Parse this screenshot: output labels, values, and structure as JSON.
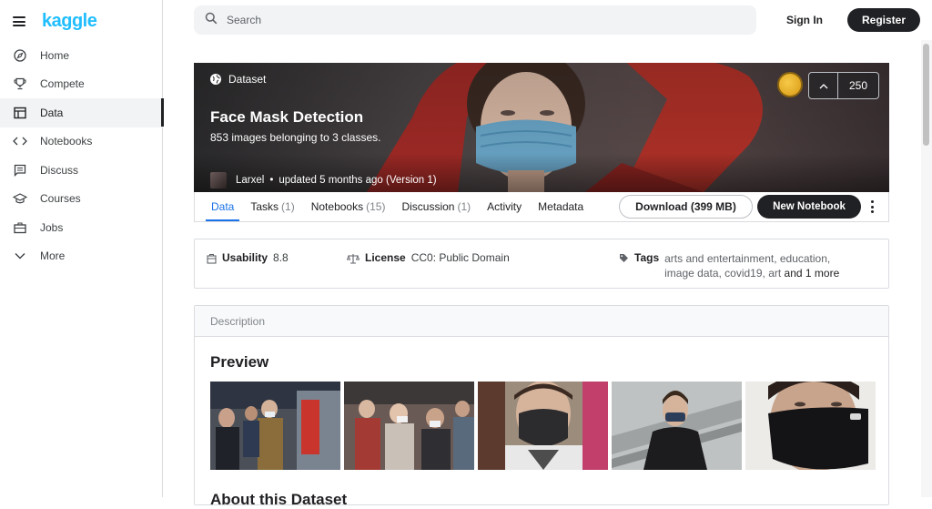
{
  "brand": {
    "logo": "kaggle",
    "logo_color": "#20beff"
  },
  "sidebar": {
    "items": [
      {
        "label": "Home",
        "icon": "compass-icon"
      },
      {
        "label": "Compete",
        "icon": "trophy-icon"
      },
      {
        "label": "Data",
        "icon": "table-icon",
        "active": true
      },
      {
        "label": "Notebooks",
        "icon": "code-icon"
      },
      {
        "label": "Discuss",
        "icon": "comment-icon"
      },
      {
        "label": "Courses",
        "icon": "graduation-cap-icon"
      },
      {
        "label": "Jobs",
        "icon": "briefcase-icon"
      },
      {
        "label": "More",
        "icon": "chevron-down-icon"
      }
    ]
  },
  "header": {
    "search_placeholder": "Search",
    "signin": "Sign In",
    "register": "Register"
  },
  "dataset": {
    "type": "Dataset",
    "title": "Face Mask Detection",
    "subtitle": "853 images belonging to 3 classes.",
    "author": "Larxel",
    "updated": "updated 5 months ago (Version 1)",
    "upvotes": "250",
    "medal_color": "#f0b429"
  },
  "tabs": [
    {
      "label": "Data",
      "count": "",
      "active": true
    },
    {
      "label": "Tasks",
      "count": "(1)"
    },
    {
      "label": "Notebooks",
      "count": "(15)"
    },
    {
      "label": "Discussion",
      "count": "(1)"
    },
    {
      "label": "Activity",
      "count": ""
    },
    {
      "label": "Metadata",
      "count": ""
    }
  ],
  "actions": {
    "download": "Download (399 MB)",
    "new_notebook": "New Notebook"
  },
  "meta": {
    "usability_label": "Usability",
    "usability_value": "8.8",
    "license_label": "License",
    "license_value": "CC0: Public Domain",
    "tags_label": "Tags",
    "tags_line1": "arts and entertainment, education,",
    "tags_line2_a": "image data, covid19, art",
    "tags_line2_b": "and 1 more"
  },
  "description": {
    "header": "Description",
    "preview_title": "Preview",
    "next_title": "About this Dataset"
  },
  "accent": "#1a73e8"
}
